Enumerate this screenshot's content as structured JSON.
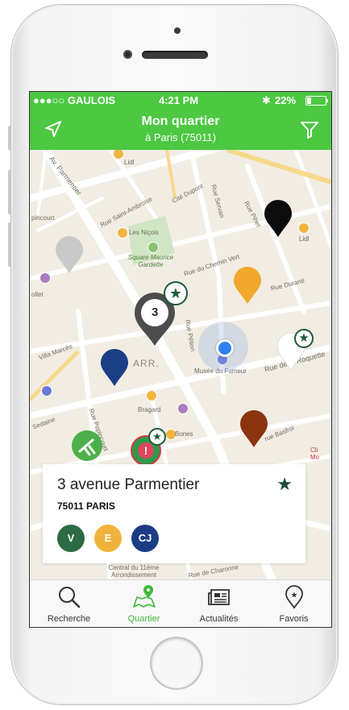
{
  "status_bar": {
    "carrier": "●●●○○ GAULOIS",
    "time": "4:21 PM",
    "battery": "22%"
  },
  "nav": {
    "title": "Mon quartier",
    "subtitle": "à Paris (75011)"
  },
  "map": {
    "labels": {
      "parmentier": "Av. Parmentier",
      "lidl_top": "Lidl",
      "saint_ambroise": "Rue Saint-Ambroise",
      "cite_dupont": "Cité Dupont",
      "servan": "Rue Servan",
      "lidl_right": "Lidl",
      "les_nicois": "Les Niçois",
      "square": "Square Maurice Gardette",
      "chemin_vert": "Rue du Chemin Vert",
      "duranti": "Rue Duranti",
      "popincourt": "pincourt",
      "folie": "ollet",
      "arr": "ARR.",
      "musee": "Musée du Fumeur",
      "roquette": "Rue de la Roquette",
      "villa_marces": "Villa Marcès",
      "bragard": "Bragard",
      "sedaine": "Sedaine",
      "rue_popincourt": "Rue Popincourt",
      "bones": "Bones",
      "basfroi": "rue Basfroi",
      "central": "Central du 11ème Arrondissement",
      "charonne": "Rue de Charonne",
      "pleinot": "Rue Pétion",
      "picard": "Rue Pihet"
    },
    "cluster_count": "3",
    "pin_colors": {
      "grey": "#c9c9c9",
      "black": "#0c0c0c",
      "orange": "#f0a92c",
      "navy": "#1a3f86",
      "white": "#ffffff",
      "brown": "#8a3410",
      "cluster": "#4d4d4d"
    }
  },
  "card": {
    "address": "3 avenue Parmentier",
    "city": "75011 PARIS",
    "badges": [
      {
        "label": "V",
        "color": "#2c6b43"
      },
      {
        "label": "E",
        "color": "#f1b23b"
      },
      {
        "label": "CJ",
        "color": "#1b3c86"
      }
    ]
  },
  "tabs": [
    {
      "label": "Recherche",
      "icon": "search-icon",
      "active": false
    },
    {
      "label": "Quartier",
      "icon": "map-pin-icon",
      "active": true
    },
    {
      "label": "Actualités",
      "icon": "newspaper-icon",
      "active": false
    },
    {
      "label": "Favoris",
      "icon": "star-pin-icon",
      "active": false
    }
  ],
  "colors": {
    "accent": "#4cc842",
    "active_tab": "#3fb83a"
  }
}
